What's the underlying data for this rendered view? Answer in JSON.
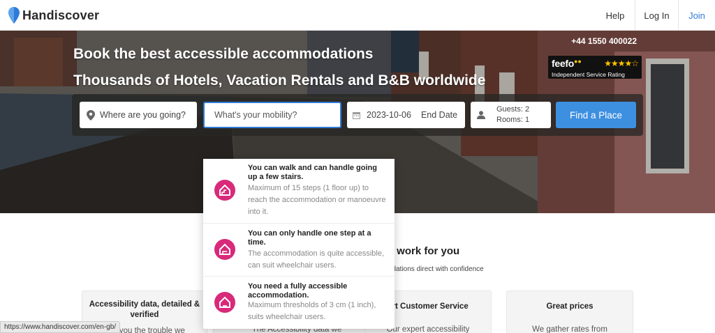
{
  "header": {
    "brand": "Handiscover",
    "nav": {
      "help": "Help",
      "login": "Log In",
      "join": "Join"
    }
  },
  "hero": {
    "headline1": "Book the best accessible accommodations",
    "headline2": "Thousands of Hotels, Vacation Rentals and B&B worldwide",
    "phone": "+44 1550 400022",
    "feefo": {
      "logo": "feefo",
      "rating_label": "Independent Service Rating",
      "stars": 4.5
    }
  },
  "search": {
    "where_placeholder": "Where are you going?",
    "mobility_placeholder": "What's your mobility?",
    "start_date": "2023-10-06",
    "end_date": "End Date",
    "guests": "Guests: 2",
    "rooms": "Rooms: 1",
    "find_label": "Find a Place"
  },
  "mobility_options": [
    {
      "title": "You can walk and can handle going up a few stairs.",
      "desc": "Maximum of 15 steps (1 floor up) to reach the accommodation or manoeuvre into it."
    },
    {
      "title": "You can only handle one step at a time.",
      "desc": "The accommodation is quite accessible, can suit wheelchair users."
    },
    {
      "title": "You need a fully accessible accommodation.",
      "desc": "Maximum thresholds of 3 cm (1 inch), suits wheelchair users."
    }
  ],
  "section": {
    "title_partial": "rd work for you",
    "sub_partial": "odations direct with confidence"
  },
  "cards": [
    {
      "title": "Accessibility data, detailed & verified",
      "text": "ave you the trouble we"
    },
    {
      "title": "",
      "text": "The Accessibility data we"
    },
    {
      "title": "ert Customer Service",
      "text": "Our expert accessibility"
    },
    {
      "title": "Great prices",
      "text": "We gather rates from"
    }
  ],
  "status_url": "https://www.handiscover.com/en-gb/",
  "colors": {
    "accent": "#3d8fe0",
    "mobility_icon": "#d8297a",
    "brand_pin": "#2f7bd8"
  }
}
